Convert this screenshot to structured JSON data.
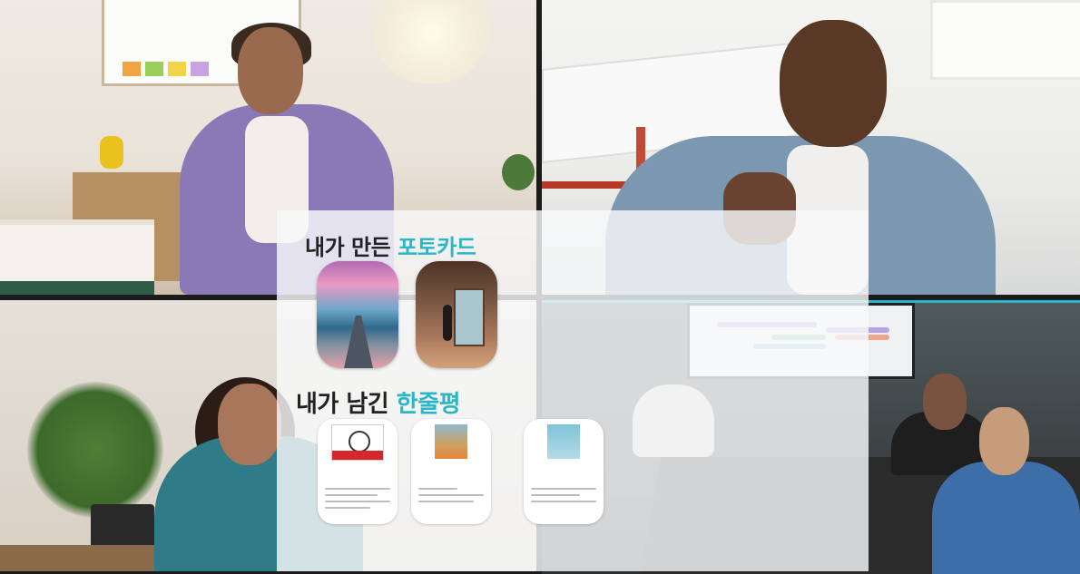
{
  "overlay": {
    "section1": {
      "text": "내가 만든 ",
      "accent": "포토카드"
    },
    "section2": {
      "text": "내가 남긴 ",
      "accent": "한줄평"
    },
    "accent_color": "#2bb6c7"
  },
  "photocards": [
    {
      "name": "photocard-anime-road"
    },
    {
      "name": "photocard-anime-room"
    }
  ],
  "reviews": [
    {
      "cover_label": "",
      "title": "",
      "subtitle": ""
    },
    {
      "cover_label": "",
      "title": "",
      "subtitle": ""
    },
    {
      "cover_label": "",
      "title": "",
      "subtitle": ""
    }
  ],
  "video_tiles": [
    {
      "name": "video-tile-top-left"
    },
    {
      "name": "video-tile-top-right"
    },
    {
      "name": "video-tile-bottom-left"
    },
    {
      "name": "video-tile-bottom-right"
    }
  ]
}
